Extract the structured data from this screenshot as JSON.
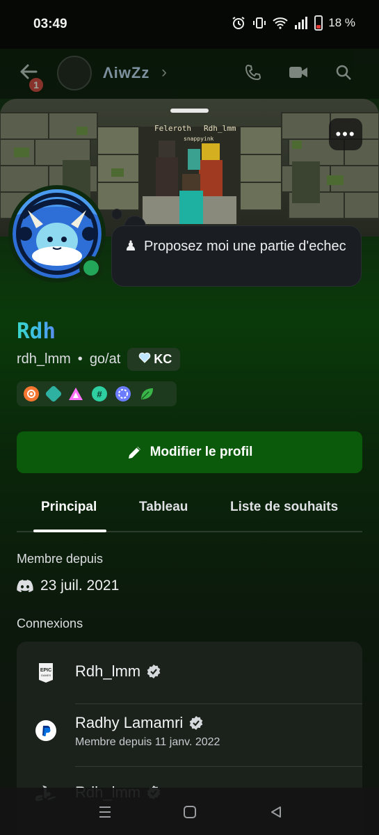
{
  "status_bar": {
    "time": "03:49",
    "battery": "18 %",
    "icons": [
      "alarm-icon",
      "vibrate-icon",
      "wifi-icon",
      "signal-icon",
      "battery-icon"
    ]
  },
  "header": {
    "back_icon": "arrow-left-icon",
    "unread_count": "1",
    "channel_name": "ΛiwZz",
    "icons": [
      "phone-call-icon",
      "video-icon",
      "search-icon"
    ]
  },
  "profile": {
    "banner_labels": [
      "Feleroth",
      "Rdh_lmm",
      "snappyink"
    ],
    "status_text": "Proposez moi une partie d'echec",
    "status_emoji": "♟",
    "display_name": "Rdh",
    "username": "rdh_lmm",
    "pronouns": "go/at",
    "separator": "•",
    "guild_tag": "KC",
    "online_color": "#23a55a",
    "badges": [
      "hypesquad-balance-icon",
      "active-developer-icon",
      "nitro-icon",
      "hashtag-icon",
      "boost-icon",
      "leaf-icon"
    ]
  },
  "actions": {
    "edit_label": "Modifier le profil"
  },
  "tabs": [
    "Principal",
    "Tableau",
    "Liste de souhaits"
  ],
  "member_since": {
    "label": "Membre depuis",
    "date": "23 juil. 2021"
  },
  "connections": {
    "label": "Connexions",
    "items": [
      {
        "service": "epic-games-icon",
        "name": "Rdh_lmm",
        "verified": true,
        "sub": ""
      },
      {
        "service": "paypal-icon",
        "name": "Radhy Lamamri",
        "verified": true,
        "sub": "Membre depuis 11 janv. 2022"
      },
      {
        "service": "playstation-icon",
        "name": "Rdh_lmm",
        "verified": true,
        "sub": ""
      }
    ]
  },
  "nav": [
    "recents-icon",
    "home-icon",
    "back-icon"
  ],
  "colors": {
    "accent_green": "#0b5a0b",
    "name_gradient_start": "#3ad6c9",
    "name_gradient_end": "#5a8cf0"
  }
}
